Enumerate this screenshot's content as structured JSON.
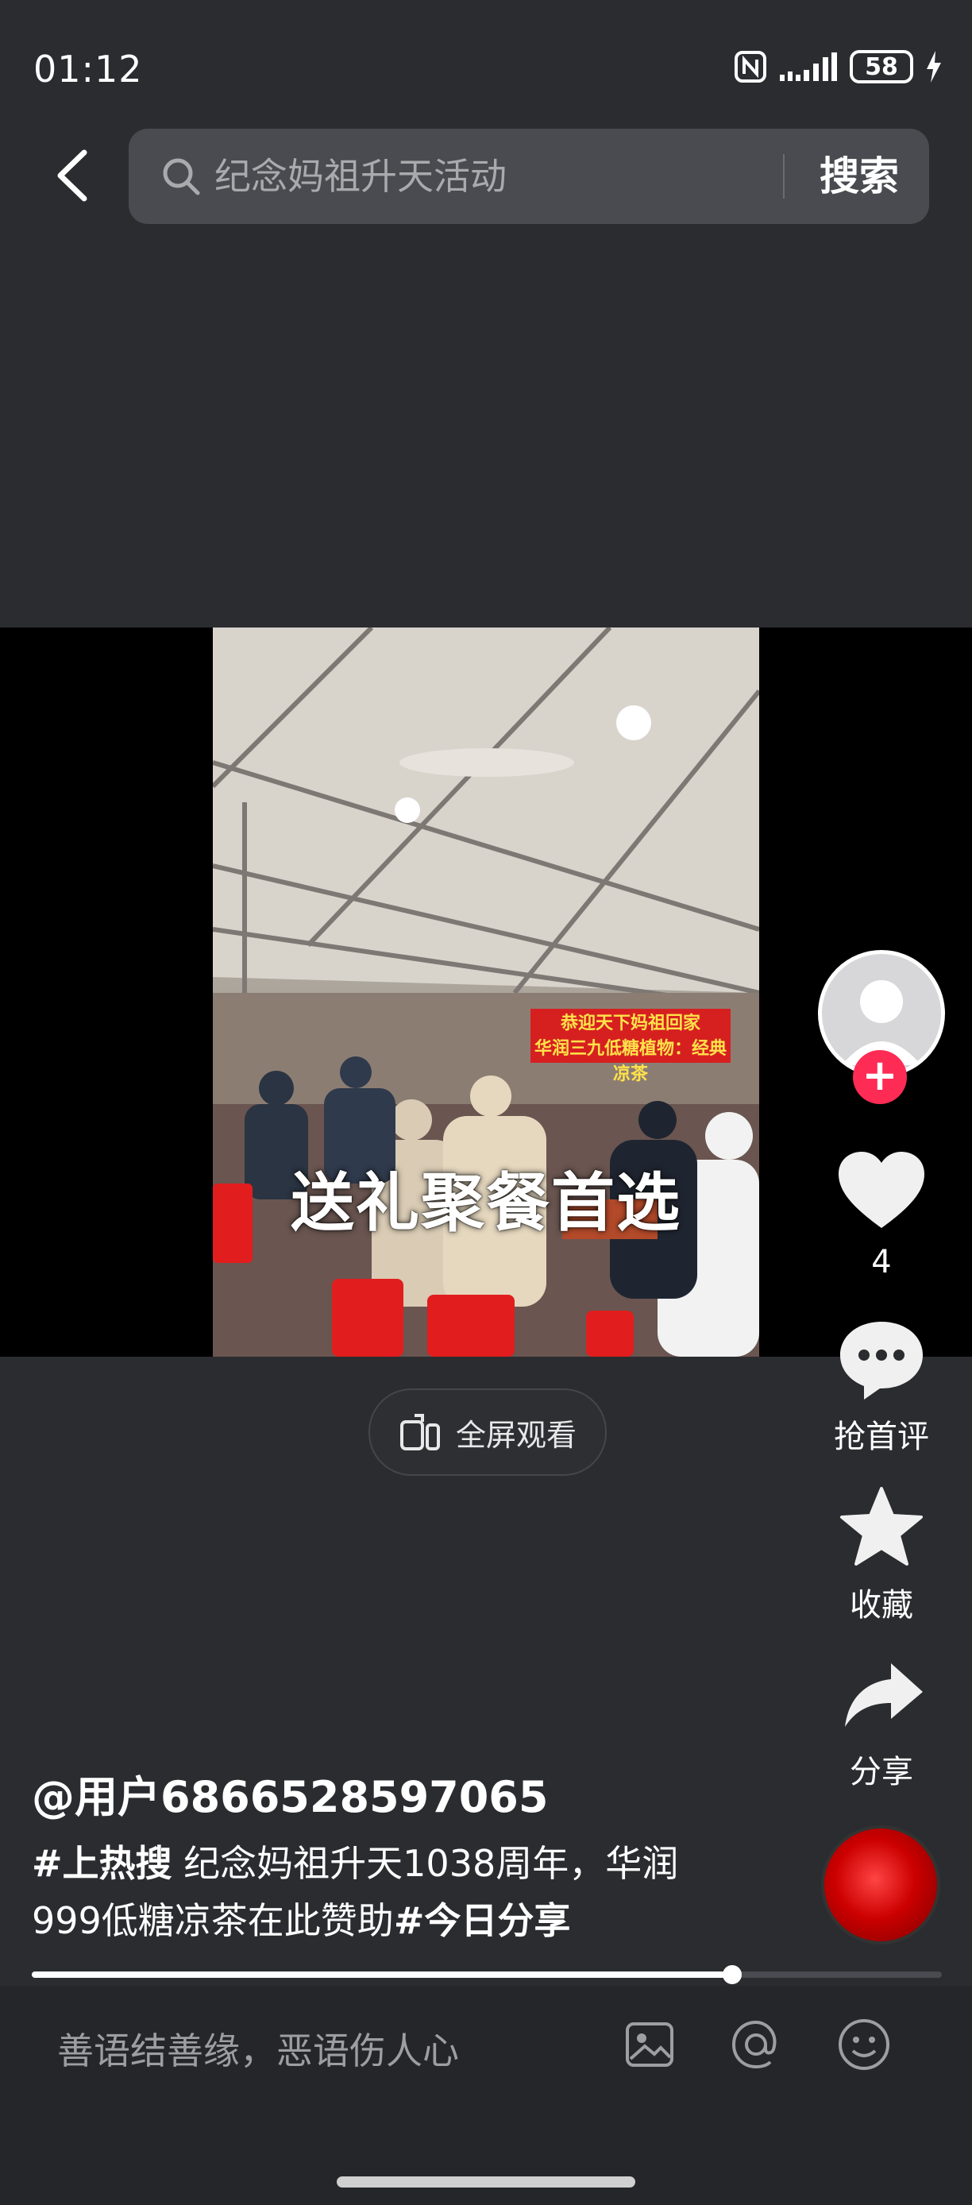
{
  "status_bar": {
    "time": "01:12",
    "battery": "58"
  },
  "search": {
    "query": "纪念妈祖升天活动",
    "button_label": "搜索"
  },
  "video": {
    "caption": "送礼聚餐首选",
    "banner_main": "恭迎天下妈祖回家",
    "banner_sub": "华润三九低糖植物：经典凉茶"
  },
  "fullscreen": {
    "label": "全屏观看"
  },
  "rail": {
    "like_count": "4",
    "comment_label": "抢首评",
    "favorite_label": "收藏",
    "share_label": "分享"
  },
  "post": {
    "author": "@用户6866528597065",
    "tag_hot": "#上热搜",
    "text": " 纪念妈祖升天1038周年，华润999低糖凉茶在此赞助",
    "tag_share": "#今日分享"
  },
  "progress": {
    "fraction": 0.77
  },
  "comment_bar": {
    "placeholder": "善语结善缘，恶语伤人心"
  }
}
